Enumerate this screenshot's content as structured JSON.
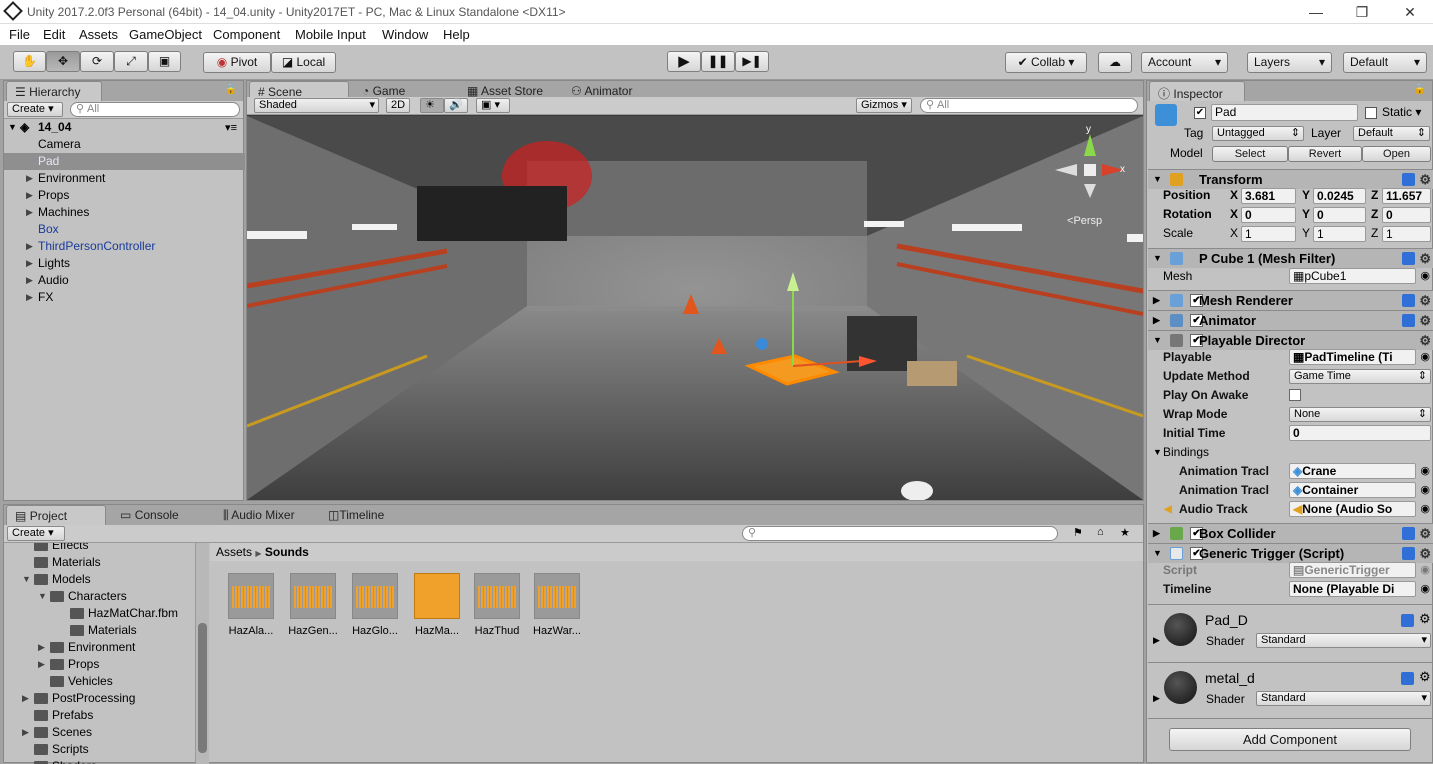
{
  "window": {
    "title": "Unity 2017.2.0f3 Personal (64bit) - 14_04.unity - Unity2017ET - PC, Mac & Linux Standalone <DX11>",
    "minimize": "—",
    "maximize": "❐",
    "close": "✕"
  },
  "menu": [
    "File",
    "Edit",
    "Assets",
    "GameObject",
    "Component",
    "Mobile Input",
    "Window",
    "Help"
  ],
  "toolbar": {
    "pivot": "Pivot",
    "local": "Local",
    "collab": "Collab",
    "account": "Account",
    "layers": "Layers",
    "layout": "Default"
  },
  "hierarchy": {
    "tab": "Hierarchy",
    "create": "Create",
    "search": "All",
    "scene": "14_04",
    "items": [
      {
        "label": "Camera",
        "expand": false,
        "style": "normal"
      },
      {
        "label": "Pad",
        "expand": false,
        "style": "selected"
      },
      {
        "label": "Environment",
        "expand": true,
        "style": "normal"
      },
      {
        "label": "Props",
        "expand": true,
        "style": "normal"
      },
      {
        "label": "Machines",
        "expand": true,
        "style": "normal"
      },
      {
        "label": "Box",
        "expand": false,
        "style": "blue"
      },
      {
        "label": "ThirdPersonController",
        "expand": true,
        "style": "blue"
      },
      {
        "label": "Lights",
        "expand": true,
        "style": "normal"
      },
      {
        "label": "Audio",
        "expand": true,
        "style": "normal"
      },
      {
        "label": "FX",
        "expand": true,
        "style": "normal"
      }
    ]
  },
  "scene_tabs": {
    "scene": "Scene",
    "game": "Game",
    "asset_store": "Asset Store",
    "animator": "Animator"
  },
  "scene_toolbar": {
    "shading": "Shaded",
    "mode2d": "2D",
    "gizmos": "Gizmos",
    "search": "All",
    "persp": "Persp",
    "axis_y": "y",
    "axis_x": "x"
  },
  "bottom_tabs": {
    "project": "Project",
    "console": "Console",
    "audio_mixer": "Audio Mixer",
    "timeline": "Timeline"
  },
  "project": {
    "create": "Create",
    "breadcrumb": [
      "Assets",
      "Sounds"
    ],
    "tree": [
      {
        "label": "Effects",
        "depth": 1,
        "expand": ""
      },
      {
        "label": "Materials",
        "depth": 1,
        "expand": ""
      },
      {
        "label": "Models",
        "depth": 1,
        "expand": "▼"
      },
      {
        "label": "Characters",
        "depth": 2,
        "expand": "▼"
      },
      {
        "label": "HazMatChar.fbm",
        "depth": 3,
        "expand": ""
      },
      {
        "label": "Materials",
        "depth": 3,
        "expand": ""
      },
      {
        "label": "Environment",
        "depth": 2,
        "expand": "▶"
      },
      {
        "label": "Props",
        "depth": 2,
        "expand": "▶"
      },
      {
        "label": "Vehicles",
        "depth": 2,
        "expand": ""
      },
      {
        "label": "PostProcessing",
        "depth": 1,
        "expand": "▶"
      },
      {
        "label": "Prefabs",
        "depth": 1,
        "expand": ""
      },
      {
        "label": "Scenes",
        "depth": 1,
        "expand": "▶"
      },
      {
        "label": "Scripts",
        "depth": 1,
        "expand": ""
      },
      {
        "label": "Shaders",
        "depth": 1,
        "expand": ""
      }
    ],
    "assets": [
      "HazAla...",
      "HazGen...",
      "HazGlo...",
      "HazMa...",
      "HazThud",
      "HazWar..."
    ]
  },
  "inspector": {
    "tab": "Inspector",
    "name": "Pad",
    "static": "Static",
    "tag_label": "Tag",
    "tag": "Untagged",
    "layer_label": "Layer",
    "layer": "Default",
    "model_label": "Model",
    "select": "Select",
    "revert": "Revert",
    "open": "Open",
    "transform": {
      "title": "Transform",
      "position_label": "Position",
      "rotation_label": "Rotation",
      "scale_label": "Scale",
      "x": "X",
      "y": "Y",
      "z": "Z",
      "position": [
        "3.681",
        "0.0245",
        "11.657"
      ],
      "rotation": [
        "0",
        "0",
        "0"
      ],
      "scale": [
        "1",
        "1",
        "1"
      ]
    },
    "mesh_filter": {
      "title": "P Cube 1 (Mesh Filter)",
      "mesh_label": "Mesh",
      "mesh": "pCube1"
    },
    "mesh_renderer": "Mesh Renderer",
    "animator": "Animator",
    "playable_director": {
      "title": "Playable Director",
      "playable_label": "Playable",
      "playable": "PadTimeline (Ti",
      "update_label": "Update Method",
      "update": "Game Time",
      "awake_label": "Play On Awake",
      "wrap_label": "Wrap Mode",
      "wrap": "None",
      "initial_label": "Initial Time",
      "initial": "0",
      "bindings": "Bindings",
      "binding_rows": [
        {
          "label": "Animation Tracl",
          "value": "Crane"
        },
        {
          "label": "Animation Tracl",
          "value": "Container"
        },
        {
          "label": "Audio Track",
          "value": "None (Audio So"
        }
      ]
    },
    "box_collider": "Box Collider",
    "generic_trigger": {
      "title": "Generic Trigger (Script)",
      "script_label": "Script",
      "script": "GenericTrigger",
      "timeline_label": "Timeline",
      "timeline": "None (Playable Di"
    },
    "materials": [
      {
        "name": "Pad_D",
        "shader_label": "Shader",
        "shader": "Standard"
      },
      {
        "name": "metal_d",
        "shader_label": "Shader",
        "shader": "Standard"
      }
    ],
    "add_component": "Add Component"
  }
}
